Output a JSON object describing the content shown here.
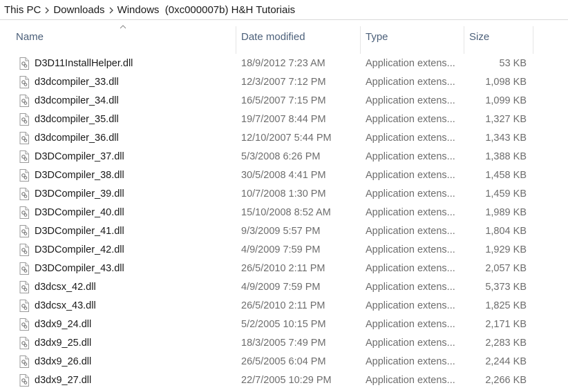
{
  "breadcrumb": {
    "items": [
      "This PC",
      "Downloads",
      "Windows  (0xc000007b) H&H Tutoriais"
    ]
  },
  "columns": {
    "name": "Name",
    "date": "Date modified",
    "type": "Type",
    "size": "Size"
  },
  "files": [
    {
      "name": "D3D11InstallHelper.dll",
      "date": "18/9/2012 7:23 AM",
      "type": "Application extens...",
      "size": "53 KB"
    },
    {
      "name": "d3dcompiler_33.dll",
      "date": "12/3/2007 7:12 PM",
      "type": "Application extens...",
      "size": "1,098 KB"
    },
    {
      "name": "d3dcompiler_34.dll",
      "date": "16/5/2007 7:15 PM",
      "type": "Application extens...",
      "size": "1,099 KB"
    },
    {
      "name": "d3dcompiler_35.dll",
      "date": "19/7/2007 8:44 PM",
      "type": "Application extens...",
      "size": "1,327 KB"
    },
    {
      "name": "d3dcompiler_36.dll",
      "date": "12/10/2007 5:44 PM",
      "type": "Application extens...",
      "size": "1,343 KB"
    },
    {
      "name": "D3DCompiler_37.dll",
      "date": "5/3/2008 6:26 PM",
      "type": "Application extens...",
      "size": "1,388 KB"
    },
    {
      "name": "D3DCompiler_38.dll",
      "date": "30/5/2008 4:41 PM",
      "type": "Application extens...",
      "size": "1,458 KB"
    },
    {
      "name": "D3DCompiler_39.dll",
      "date": "10/7/2008 1:30 PM",
      "type": "Application extens...",
      "size": "1,459 KB"
    },
    {
      "name": "D3DCompiler_40.dll",
      "date": "15/10/2008 8:52 AM",
      "type": "Application extens...",
      "size": "1,989 KB"
    },
    {
      "name": "D3DCompiler_41.dll",
      "date": "9/3/2009 5:57 PM",
      "type": "Application extens...",
      "size": "1,804 KB"
    },
    {
      "name": "D3DCompiler_42.dll",
      "date": "4/9/2009 7:59 PM",
      "type": "Application extens...",
      "size": "1,929 KB"
    },
    {
      "name": "D3DCompiler_43.dll",
      "date": "26/5/2010 2:11 PM",
      "type": "Application extens...",
      "size": "2,057 KB"
    },
    {
      "name": "d3dcsx_42.dll",
      "date": "4/9/2009 7:59 PM",
      "type": "Application extens...",
      "size": "5,373 KB"
    },
    {
      "name": "d3dcsx_43.dll",
      "date": "26/5/2010 2:11 PM",
      "type": "Application extens...",
      "size": "1,825 KB"
    },
    {
      "name": "d3dx9_24.dll",
      "date": "5/2/2005 10:15 PM",
      "type": "Application extens...",
      "size": "2,171 KB"
    },
    {
      "name": "d3dx9_25.dll",
      "date": "18/3/2005 7:49 PM",
      "type": "Application extens...",
      "size": "2,283 KB"
    },
    {
      "name": "d3dx9_26.dll",
      "date": "26/5/2005 6:04 PM",
      "type": "Application extens...",
      "size": "2,244 KB"
    },
    {
      "name": "d3dx9_27.dll",
      "date": "22/7/2005 10:29 PM",
      "type": "Application extens...",
      "size": "2,266 KB"
    }
  ],
  "icons": {
    "file": "dll-file-icon",
    "separator": "chevron-right-icon",
    "sort": "sort-ascending-icon"
  }
}
